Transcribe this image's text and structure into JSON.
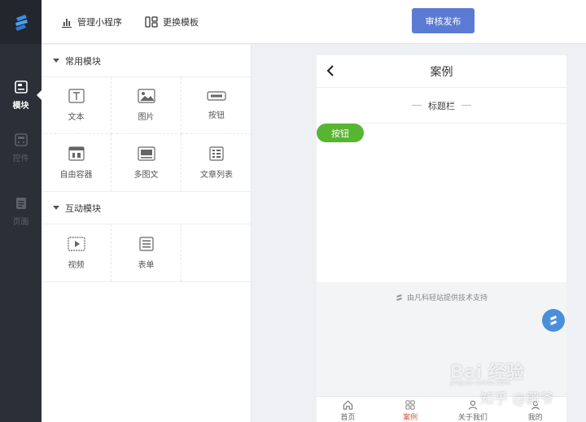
{
  "rail": {
    "items": [
      {
        "label": "模块",
        "icon": "module-icon",
        "active": true
      },
      {
        "label": "控件",
        "icon": "widget-icon",
        "active": false
      },
      {
        "label": "页面",
        "icon": "page-icon",
        "active": false
      }
    ]
  },
  "topbar": {
    "manage_label": "管理小程序",
    "template_label": "更换模板",
    "publish_label": "审核发布"
  },
  "panel": {
    "common": {
      "title": "常用模块",
      "items": [
        {
          "label": "文本",
          "icon": "text-icon"
        },
        {
          "label": "图片",
          "icon": "image-icon"
        },
        {
          "label": "按钮",
          "icon": "button-icon"
        },
        {
          "label": "自由容器",
          "icon": "container-icon"
        },
        {
          "label": "多图文",
          "icon": "multi-image-text-icon"
        },
        {
          "label": "文章列表",
          "icon": "article-list-icon"
        }
      ]
    },
    "interactive": {
      "title": "互动模块",
      "items": [
        {
          "label": "视频",
          "icon": "video-icon"
        },
        {
          "label": "表单",
          "icon": "form-icon"
        }
      ]
    }
  },
  "phone": {
    "title": "案例",
    "titlebar": "标题栏",
    "button_label": "按钮",
    "support_text": "由凡科轻站提供技术支持",
    "tabs": [
      {
        "label": "首页",
        "icon": "home-icon",
        "active": false
      },
      {
        "label": "案例",
        "icon": "grid-icon",
        "active": true
      },
      {
        "label": "关于我们",
        "icon": "user-icon",
        "active": false
      },
      {
        "label": "我的",
        "icon": "profile-icon",
        "active": false
      }
    ]
  },
  "watermark": {
    "line1": "Bai  经验",
    "line2": "知乎 @蔚爷",
    "url": "jingyan.baidu.com"
  },
  "colors": {
    "rail": "#2b2f37",
    "publish": "#5b7ad3",
    "green_button": "#58b531",
    "active_tab": "#e0533a",
    "fab": "#4a90d9"
  }
}
